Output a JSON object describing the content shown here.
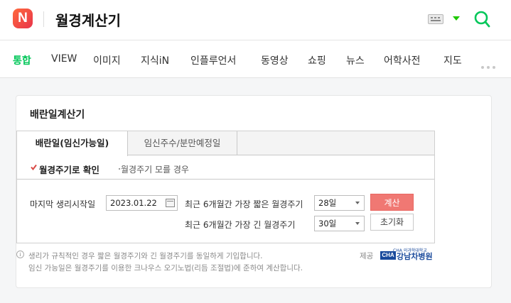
{
  "header": {
    "logo_letter": "N",
    "query": "월경계산기",
    "accent": "#03c75a"
  },
  "tabs": [
    "통합",
    "VIEW",
    "이미지",
    "지식iN",
    "인플루언서",
    "동영상",
    "쇼핑",
    "뉴스",
    "어학사전",
    "지도"
  ],
  "card": {
    "title": "배란일계산기",
    "calc_tabs": [
      "배란일(임신가능일)",
      "임신주수/분만예정일"
    ],
    "modes": {
      "selected": "월경주기로 확인",
      "other": "월경주기 모를 경우"
    },
    "form": {
      "last_period_label": "마지막 생리시작일",
      "last_period_value": "2023.01.22",
      "shortest_label": "최근 6개월간 가장 짧은 월경주기",
      "shortest_value": "28일",
      "longest_label": "최근 6개월간 가장 긴 월경주기",
      "longest_value": "30일",
      "calc_button": "계산",
      "reset_button": "초기화"
    },
    "notes": [
      "생리가 규칙적인 경우 짧은 월경주기와 긴 월경주기를 동일하게 기입합니다.",
      "임신 가능일은 월경주기를 이용한 크나우스 오기노법(리듬 조절법)에 준하여 계산합니다."
    ],
    "provider_label": "제공",
    "provider": {
      "mark": "CHA",
      "small": "CHA 의과학대학교",
      "name": "강남차병원"
    }
  },
  "colors": {
    "calc_button": "#f07873",
    "provider": "#1a4a9c"
  }
}
